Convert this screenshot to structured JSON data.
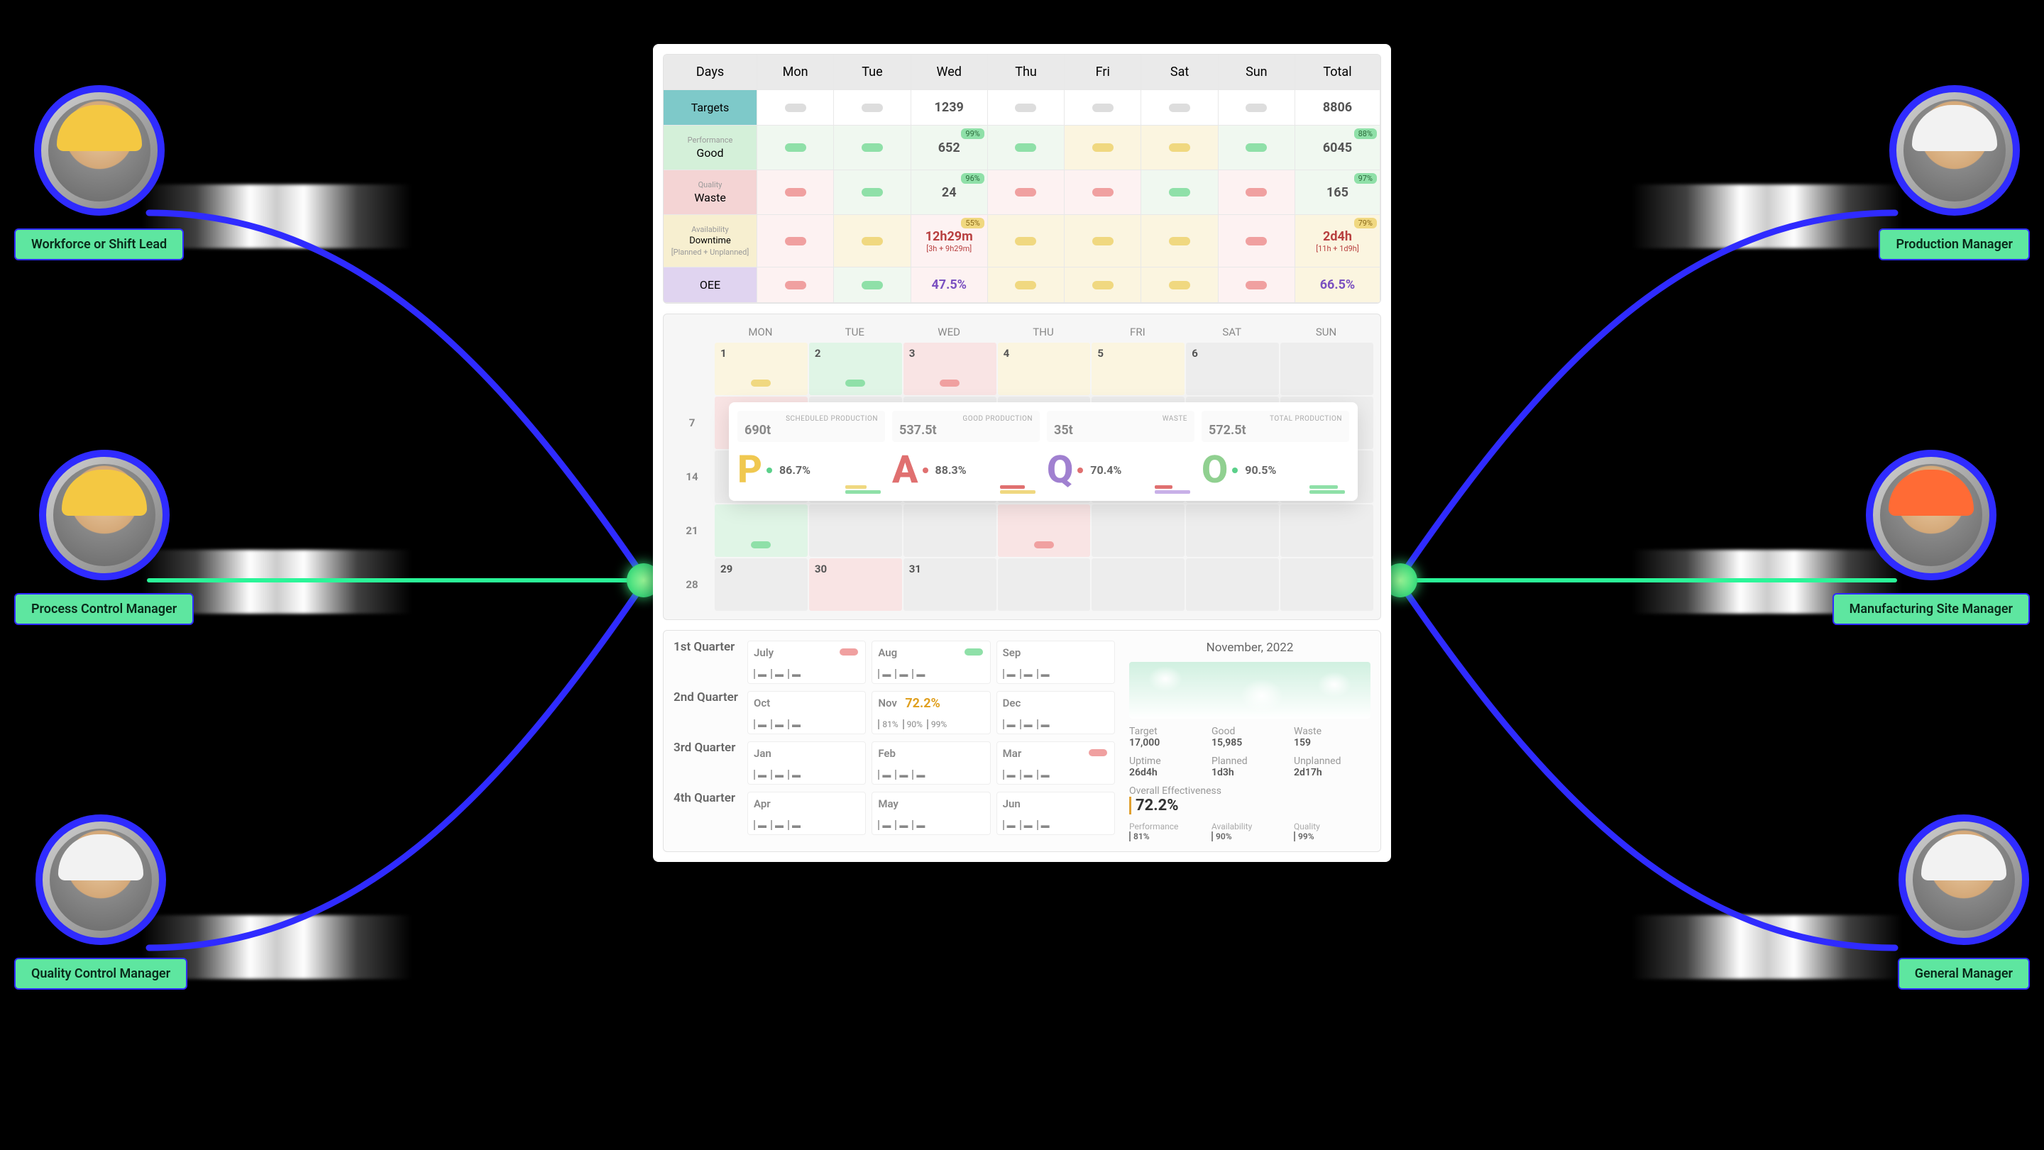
{
  "personas": {
    "left": [
      {
        "label": "Workforce or Shift Lead",
        "helmet": "yellow"
      },
      {
        "label": "Process Control Manager",
        "helmet": "yellow"
      },
      {
        "label": "Quality Control Manager",
        "helmet": "white"
      }
    ],
    "right": [
      {
        "label": "Production Manager",
        "helmet": "white"
      },
      {
        "label": "Manufacturing Site Manager",
        "helmet": "orange"
      },
      {
        "label": "General Manager",
        "helmet": "white"
      }
    ]
  },
  "table": {
    "header": [
      "Days",
      "Mon",
      "Tue",
      "Wed",
      "Thu",
      "Fri",
      "Sat",
      "Sun",
      "Total"
    ],
    "rows": {
      "targets": {
        "label": "Targets",
        "wed": "1239",
        "total": "8806"
      },
      "good": {
        "label": "Good",
        "sub": "Performance",
        "wed": "652",
        "wed_badge": "99%",
        "total": "6045",
        "total_badge": "88%"
      },
      "waste": {
        "label": "Waste",
        "sub": "Quality",
        "wed": "24",
        "wed_badge": "96%",
        "total": "165",
        "total_badge": "97%"
      },
      "downtime": {
        "label": "Downtime",
        "sub": "Availability",
        "sub2": "[Planned + Unplanned]",
        "wed": "12h29m",
        "wed_sub": "[3h + 9h29m]",
        "wed_badge": "55%",
        "total": "2d4h",
        "total_sub": "[11h + 1d9h]",
        "total_badge": "79%"
      },
      "oee": {
        "label": "OEE",
        "wed": "47.5%",
        "total": "66.5%"
      }
    }
  },
  "calendar": {
    "days": [
      "MON",
      "TUE",
      "WED",
      "THU",
      "FRI",
      "SAT",
      "SUN"
    ],
    "weeks": [
      {
        "n": "",
        "d": [
          "1",
          "2",
          "3",
          "4",
          "5",
          "6",
          ""
        ]
      },
      {
        "n": "7",
        "d": [
          "",
          "",
          "",
          "",
          "",
          "",
          ""
        ]
      },
      {
        "n": "14",
        "d": [
          "",
          "",
          "",
          "",
          "",
          "",
          ""
        ]
      },
      {
        "n": "21",
        "d": [
          "",
          "",
          "",
          "",
          "",
          "",
          ""
        ]
      },
      {
        "n": "28",
        "d": [
          "29",
          "30",
          "31",
          "",
          "",
          "",
          ""
        ]
      }
    ],
    "paqo": {
      "cards": [
        {
          "lbl": "SCHEDULED PRODUCTION",
          "val": "690t"
        },
        {
          "lbl": "GOOD PRODUCTION",
          "val": "537.5t"
        },
        {
          "lbl": "WASTE",
          "val": "35t"
        },
        {
          "lbl": "TOTAL PRODUCTION",
          "val": "572.5t"
        }
      ],
      "metrics": [
        {
          "ltr": "P",
          "pct": "86.7%",
          "dot": "g",
          "c": "p"
        },
        {
          "ltr": "A",
          "pct": "88.3%",
          "dot": "r",
          "c": "a"
        },
        {
          "ltr": "Q",
          "pct": "70.4%",
          "dot": "r",
          "c": "q"
        },
        {
          "ltr": "O",
          "pct": "90.5%",
          "dot": "g",
          "c": "o"
        }
      ]
    }
  },
  "quarters": {
    "rows": [
      {
        "lbl": "1st Quarter",
        "months": [
          {
            "m": "July",
            "p": "red"
          },
          {
            "m": "Aug",
            "p": "grn"
          },
          {
            "m": "Sep",
            "p": ""
          }
        ]
      },
      {
        "lbl": "2nd Quarter",
        "months": [
          {
            "m": "Oct",
            "p": ""
          },
          {
            "m": "Nov",
            "p": "",
            "hl": "72.2%",
            "pcts": [
              "81%",
              "90%",
              "99%"
            ]
          },
          {
            "m": "Dec",
            "p": ""
          }
        ]
      },
      {
        "lbl": "3rd Quarter",
        "months": [
          {
            "m": "Jan",
            "p": ""
          },
          {
            "m": "Feb",
            "p": ""
          },
          {
            "m": "Mar",
            "p": "red"
          }
        ]
      },
      {
        "lbl": "4th Quarter",
        "months": [
          {
            "m": "Apr",
            "p": ""
          },
          {
            "m": "May",
            "p": ""
          },
          {
            "m": "Jun",
            "p": ""
          }
        ]
      }
    ],
    "panel": {
      "title": "November, 2022",
      "kv1": [
        {
          "k": "Target",
          "v": "17,000"
        },
        {
          "k": "Good",
          "v": "15,985"
        },
        {
          "k": "Waste",
          "v": "159"
        }
      ],
      "kv2": [
        {
          "k": "Uptime",
          "v": "26d4h"
        },
        {
          "k": "Planned",
          "v": "1d3h"
        },
        {
          "k": "Unplanned",
          "v": "2d17h"
        }
      ],
      "oe_lbl": "Overall Effectiveness",
      "oe_val": "72.2%",
      "tri": [
        {
          "k": "Performance",
          "v": "81%"
        },
        {
          "k": "Availability",
          "v": "90%"
        },
        {
          "k": "Quality",
          "v": "99%"
        }
      ]
    }
  }
}
